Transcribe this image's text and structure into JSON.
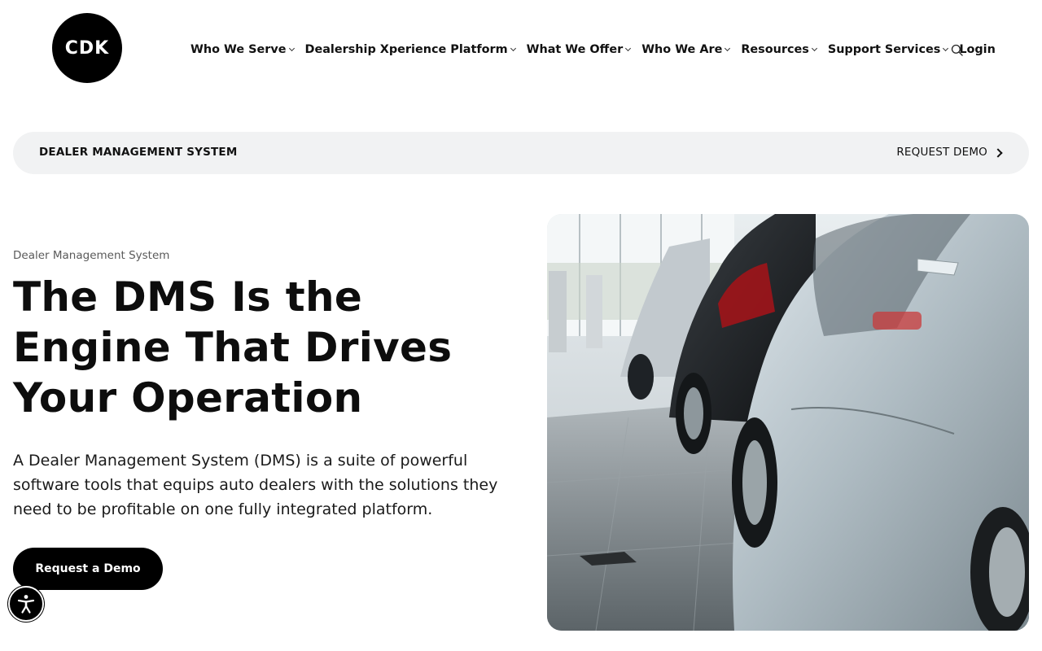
{
  "header": {
    "logo_text": "CDK",
    "nav": [
      {
        "label": "Who We Serve",
        "has_dropdown": true
      },
      {
        "label": "Dealership Xperience Platform",
        "has_dropdown": true
      },
      {
        "label": "What We Offer",
        "has_dropdown": true
      },
      {
        "label": "Who We Are",
        "has_dropdown": true
      },
      {
        "label": "Resources",
        "has_dropdown": true
      },
      {
        "label": "Support Services",
        "has_dropdown": true
      },
      {
        "label": "Login",
        "has_dropdown": false
      }
    ],
    "search_icon": "search-icon"
  },
  "subnav": {
    "title": "DEALER MANAGEMENT SYSTEM",
    "cta_label": "REQUEST DEMO"
  },
  "hero": {
    "eyebrow": "Dealer Management System",
    "title": "The DMS Is the Engine That Drives Your Operation",
    "body": "A Dealer Management System (DMS) is a suite of powerful software tools that equips auto dealers with the solutions they need to be profitable on one fully integrated platform.",
    "cta_label": "Request a Demo",
    "image_icon": "showroom-cars-photo"
  },
  "accessibility": {
    "icon": "accessibility-icon"
  },
  "colors": {
    "brand_black": "#000000",
    "subnav_bg": "#f1f2f3",
    "text": "#111111",
    "muted_text": "#5a5a5a"
  }
}
